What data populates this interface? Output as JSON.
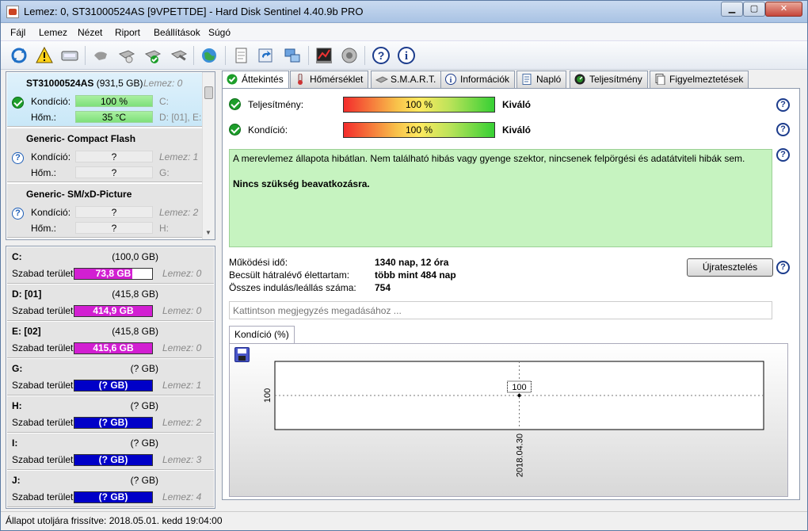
{
  "window": {
    "title": "Lemez: 0, ST31000524AS [9VPETTDE]  -  Hard Disk Sentinel 4.40.9b PRO",
    "min_label": "▁",
    "max_label": "▢",
    "close_label": "✕"
  },
  "menu": [
    "Fájl",
    "Lemez",
    "Nézet",
    "Riport",
    "Beállítások",
    "Súgó"
  ],
  "toolbar_icons": [
    "refresh-icon",
    "alert-icon",
    "disk-icon",
    "hand-icon",
    "drive-info-icon",
    "drive-ok-icon",
    "drive-tool-icon",
    "globe-icon",
    "report-icon",
    "sync-icon",
    "network-icon",
    "benchmark-icon",
    "sound-icon",
    "help-icon",
    "info-icon"
  ],
  "disks": [
    {
      "name": "ST31000524AS",
      "size": "(931,5 GB)",
      "lemez": "Lemez: 0",
      "kondicio_label": "Kondíció:",
      "kondicio_val": "100 %",
      "hom_label": "Hőm.:",
      "hom_val": "35 °C",
      "side1": "C:",
      "side2": "D: [01], E: [",
      "status": "ok"
    },
    {
      "name": "Generic- Compact Flash",
      "size": "",
      "lemez": "Lemez: 1",
      "kondicio_label": "Kondíció:",
      "kondicio_val": "?",
      "hom_label": "Hőm.:",
      "hom_val": "?",
      "side1": "",
      "side2": "G:",
      "status": "unknown"
    },
    {
      "name": "Generic- SM/xD-Picture",
      "size": "",
      "lemez": "Lemez: 2",
      "kondicio_label": "Kondíció:",
      "kondicio_val": "?",
      "hom_label": "Hőm.:",
      "hom_val": "?",
      "side1": "",
      "side2": "H:",
      "status": "unknown"
    }
  ],
  "volumes": [
    {
      "name": "C:",
      "size": "(100,0 GB)",
      "label": "Szabad terület",
      "free": "73,8 GB",
      "lemez": "Lemez: 0",
      "fill": 0.74
    },
    {
      "name": "D: [01]",
      "size": "(415,8 GB)",
      "label": "Szabad terület",
      "free": "414,9 GB",
      "lemez": "Lemez: 0",
      "fill": 1
    },
    {
      "name": "E: [02]",
      "size": "(415,8 GB)",
      "label": "Szabad terület",
      "free": "415,6 GB",
      "lemez": "Lemez: 0",
      "fill": 1
    },
    {
      "name": "G:",
      "size": "(? GB)",
      "label": "Szabad terület",
      "free": "(? GB)",
      "lemez": "Lemez: 1",
      "fill": 0
    },
    {
      "name": "H:",
      "size": "(? GB)",
      "label": "Szabad terület",
      "free": "(? GB)",
      "lemez": "Lemez: 2",
      "fill": 0
    },
    {
      "name": "I:",
      "size": "(? GB)",
      "label": "Szabad terület",
      "free": "(? GB)",
      "lemez": "Lemez: 3",
      "fill": 0
    },
    {
      "name": "J:",
      "size": "(? GB)",
      "label": "Szabad terület",
      "free": "(? GB)",
      "lemez": "Lemez: 4",
      "fill": 0
    }
  ],
  "tabs": [
    {
      "label": "Áttekintés",
      "icon": "check-icon"
    },
    {
      "label": "Hőmérséklet",
      "icon": "thermometer-icon"
    },
    {
      "label": "S.M.A.R.T.",
      "icon": "smart-icon"
    },
    {
      "label": "Információk",
      "icon": "info-icon"
    },
    {
      "label": "Napló",
      "icon": "log-icon"
    },
    {
      "label": "Teljesítmény",
      "icon": "speedometer-icon"
    },
    {
      "label": "Figyelmeztetések",
      "icon": "warnings-icon"
    }
  ],
  "overview": {
    "performance_label": "Teljesítmény:",
    "performance_value": "100 %",
    "performance_verdict": "Kiváló",
    "condition_label": "Kondíció:",
    "condition_value": "100 %",
    "condition_verdict": "Kiváló",
    "status_text": "A merevlemez állapota hibátlan. Nem található hibás vagy gyenge szektor, nincsenek felpörgési és adatátviteli hibák sem.",
    "status_action": "Nincs szükség beavatkozásra.",
    "uptime_label": "Működési idő:",
    "uptime_value": "1340 nap, 12 óra",
    "lifetime_label": "Becsült hátralévő élettartam:",
    "lifetime_value": "több mint 484 nap",
    "startstop_label": "Összes indulás/leállás száma:",
    "startstop_value": "754",
    "retest_label": "Újratesztelés",
    "note_placeholder": "Kattintson megjegyzés megadásához ..."
  },
  "chart_tab_label": "Kondíció  (%)",
  "chart_data": {
    "type": "line",
    "x": [
      "2018.04.30"
    ],
    "series": [
      {
        "values": [
          100
        ]
      }
    ],
    "ytick_labels": [
      "100"
    ],
    "xtick_labels": [
      "2018.04.30"
    ],
    "point_labels": [
      "100"
    ]
  },
  "statusbar": "Állapot utoljára frissítve: 2018.05.01. kedd 19:04:00"
}
